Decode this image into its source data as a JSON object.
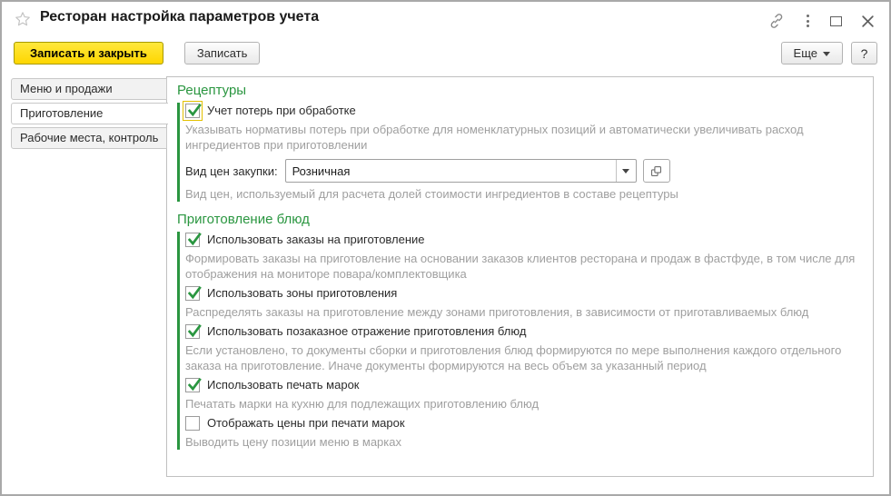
{
  "window": {
    "title": "Ресторан настройка параметров учета"
  },
  "icons": {
    "favorite": "star-icon",
    "link": "link-icon",
    "menu": "kebab-icon",
    "maximize": "maximize-icon",
    "close": "close-icon",
    "dropdown": "chevron-down-icon",
    "open_field": "open-in-form-icon",
    "checkmark": "check-icon"
  },
  "toolbar": {
    "save_and_close": "Записать и закрыть",
    "save": "Записать",
    "more": "Еще",
    "help": "?"
  },
  "sidebar": {
    "tabs": [
      {
        "label": "Меню и продажи",
        "selected": false
      },
      {
        "label": "Приготовление",
        "selected": true
      },
      {
        "label": "Рабочие места, контроль",
        "selected": false
      }
    ]
  },
  "content": {
    "recipes": {
      "title": "Рецептуры",
      "loss_checkbox": {
        "label": "Учет потерь при обработке",
        "checked": true
      },
      "loss_hint": "Указывать нормативы потерь при обработке для номенклатурных позиций и автоматически увеличивать расход ингредиентов при приготовлении",
      "price_field": {
        "label": "Вид цен закупки:",
        "value": "Розничная"
      },
      "price_hint": "Вид цен, используемый для расчета долей стоимости ингредиентов в составе рецептуры"
    },
    "cooking": {
      "title": "Приготовление блюд",
      "orders_checkbox": {
        "label": "Использовать заказы на приготовление",
        "checked": true
      },
      "orders_hint": "Формировать заказы на приготовление на основании заказов клиентов ресторана и продаж в фастфуде, в том числе для отображения на мониторе повара/комплектовщика",
      "zones_checkbox": {
        "label": "Использовать зоны приготовления",
        "checked": true
      },
      "zones_hint": "Распределять заказы на приготовление между зонами приготовления, в зависимости от приготавливаемых блюд",
      "per_order_checkbox": {
        "label": "Использовать позаказное отражение приготовления блюд",
        "checked": true
      },
      "per_order_hint": "Если установлено, то документы сборки и приготовления блюд формируются по мере выполнения каждого отдельного заказа на приготовление. Иначе документы формируются на весь объем за указанный период",
      "marks_checkbox": {
        "label": "Использовать печать марок",
        "checked": true
      },
      "marks_hint": "Печатать марки на кухню для подлежащих приготовлению блюд",
      "mark_prices_checkbox": {
        "label": "Отображать цены при печати марок",
        "checked": false
      },
      "mark_prices_hint": "Выводить цену позиции меню в марках"
    }
  },
  "colors": {
    "accent_green": "#2a9640",
    "primary_button_yellow": "#fed600",
    "focus_outline_yellow": "#e3c100",
    "hint_gray": "#9f9f9f"
  }
}
